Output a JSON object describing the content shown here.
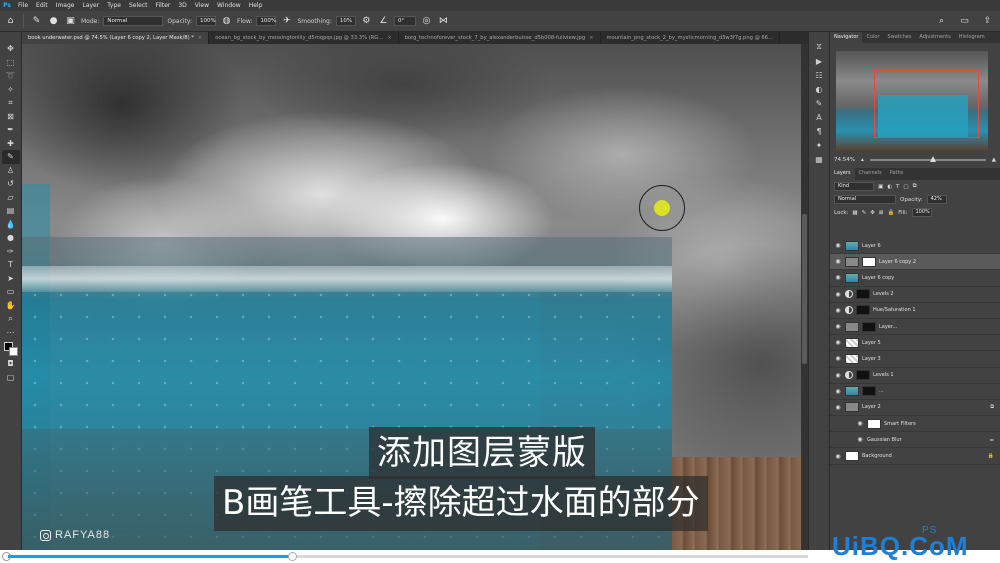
{
  "menu": {
    "logo": "Ps",
    "items": [
      "File",
      "Edit",
      "Image",
      "Layer",
      "Type",
      "Select",
      "Filter",
      "3D",
      "View",
      "Window",
      "Help"
    ]
  },
  "options": {
    "mode_label": "Mode:",
    "mode_value": "Normal",
    "opacity_label": "Opacity:",
    "opacity_value": "100%",
    "flow_label": "Flow:",
    "flow_value": "100%",
    "smoothing_label": "Smoothing:",
    "smoothing_value": "10%",
    "angle_value": "0°"
  },
  "tabs": [
    {
      "label": "book underwater.psd @ 74.5% (Layer 6 copy 2, Layer Mask/8) *",
      "active": true
    },
    {
      "label": "ocean_bg_stock_by_mossingtonlily_d5mqpqs.jpg @ 33.3% (RG...",
      "active": false
    },
    {
      "label": "borg_technoforever_stock_7_by_alexanderbuisse_d5b008-fullview.jpg",
      "active": false
    },
    {
      "label": "mountain_png_stock_2_by_mysticmorning_d3w3f7g.png @ 66...",
      "active": false
    }
  ],
  "captions": {
    "line1": "添加图层蒙版",
    "line2": "B画笔工具-擦除超过水面的部分",
    "watermark": "RAFYA88"
  },
  "navigator": {
    "tabs": [
      "Navigator",
      "Color",
      "Swatches",
      "Adjustments",
      "Histogram"
    ],
    "zoom": "74.54%"
  },
  "layers_panel": {
    "tabs": [
      "Layers",
      "Channels",
      "Paths"
    ],
    "filter_kind": "Kind",
    "blend_mode": "Normal",
    "opacity_label": "Opacity:",
    "opacity_value": "42%",
    "lock_label": "Lock:",
    "fill_label": "Fill:",
    "fill_value": "100%",
    "layers": [
      {
        "name": "Layer 6",
        "selected": false
      },
      {
        "name": "Layer 6 copy 2",
        "selected": true
      },
      {
        "name": "Layer 6 copy",
        "selected": false
      },
      {
        "name": "Levels 2",
        "selected": false
      },
      {
        "name": "Hue/Saturation 1",
        "selected": false
      },
      {
        "name": "Layer...",
        "selected": false
      },
      {
        "name": "Layer 5",
        "selected": false
      },
      {
        "name": "Layer 3",
        "selected": false
      },
      {
        "name": "Levels 1",
        "selected": false
      },
      {
        "name": "...",
        "selected": false
      },
      {
        "name": "Layer 2",
        "selected": false
      },
      {
        "name": "Smart Filters",
        "selected": false
      },
      {
        "name": "Gaussian Blur",
        "selected": false
      },
      {
        "name": "Background",
        "selected": false
      }
    ]
  },
  "site_mark": "UiBQ.CoM",
  "site_mark_sub": "PS",
  "video": {
    "progress_fraction": 0.355
  },
  "colors": {
    "accent": "#1aa0e0",
    "brush": "#d8e02a",
    "nav_box": "#e64a3a"
  }
}
